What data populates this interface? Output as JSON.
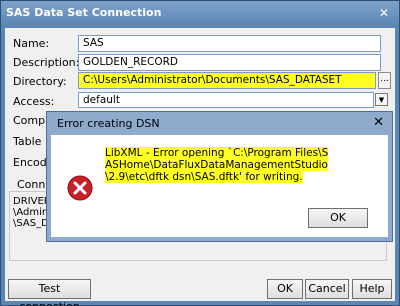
{
  "window": {
    "title": "SAS Data Set Connection",
    "close_glyph": "✕"
  },
  "form": {
    "name_label": "Name:",
    "name_value": "SAS",
    "description_label": "Description:",
    "description_value": "GOLDEN_RECORD",
    "directory_label": "Directory:",
    "directory_value": "C:\\Users\\Administrator\\Documents\\SAS_DATASET",
    "browse_label": "...",
    "access_label": "Access:",
    "access_value": "default",
    "compression_label": "Compre",
    "table_lock_label": "Table lo",
    "encoding_label": "Encodin",
    "connection_label": "Conne",
    "connection_lines": [
      "DRIVER",
      "\\Admin",
      "\\SAS_D"
    ],
    "dropdown_glyph": "▼"
  },
  "buttons": {
    "test": "Test connection",
    "ok": "OK",
    "cancel": "Cancel",
    "help": "Help"
  },
  "error_dialog": {
    "title": "Error creating DSN",
    "close_glyph": "✕",
    "message": "LibXML - Error opening `C:\\Program Files\\SASHome\\DataFluxDataManagementStudio\\2.9\\etc\\dftk dsn\\SAS.dftk' for writing.",
    "ok": "OK",
    "icon": "error-icon"
  },
  "colors": {
    "highlight": "#ffff24",
    "title_bar": "#5a84b3",
    "error_red": "#c8202a"
  }
}
